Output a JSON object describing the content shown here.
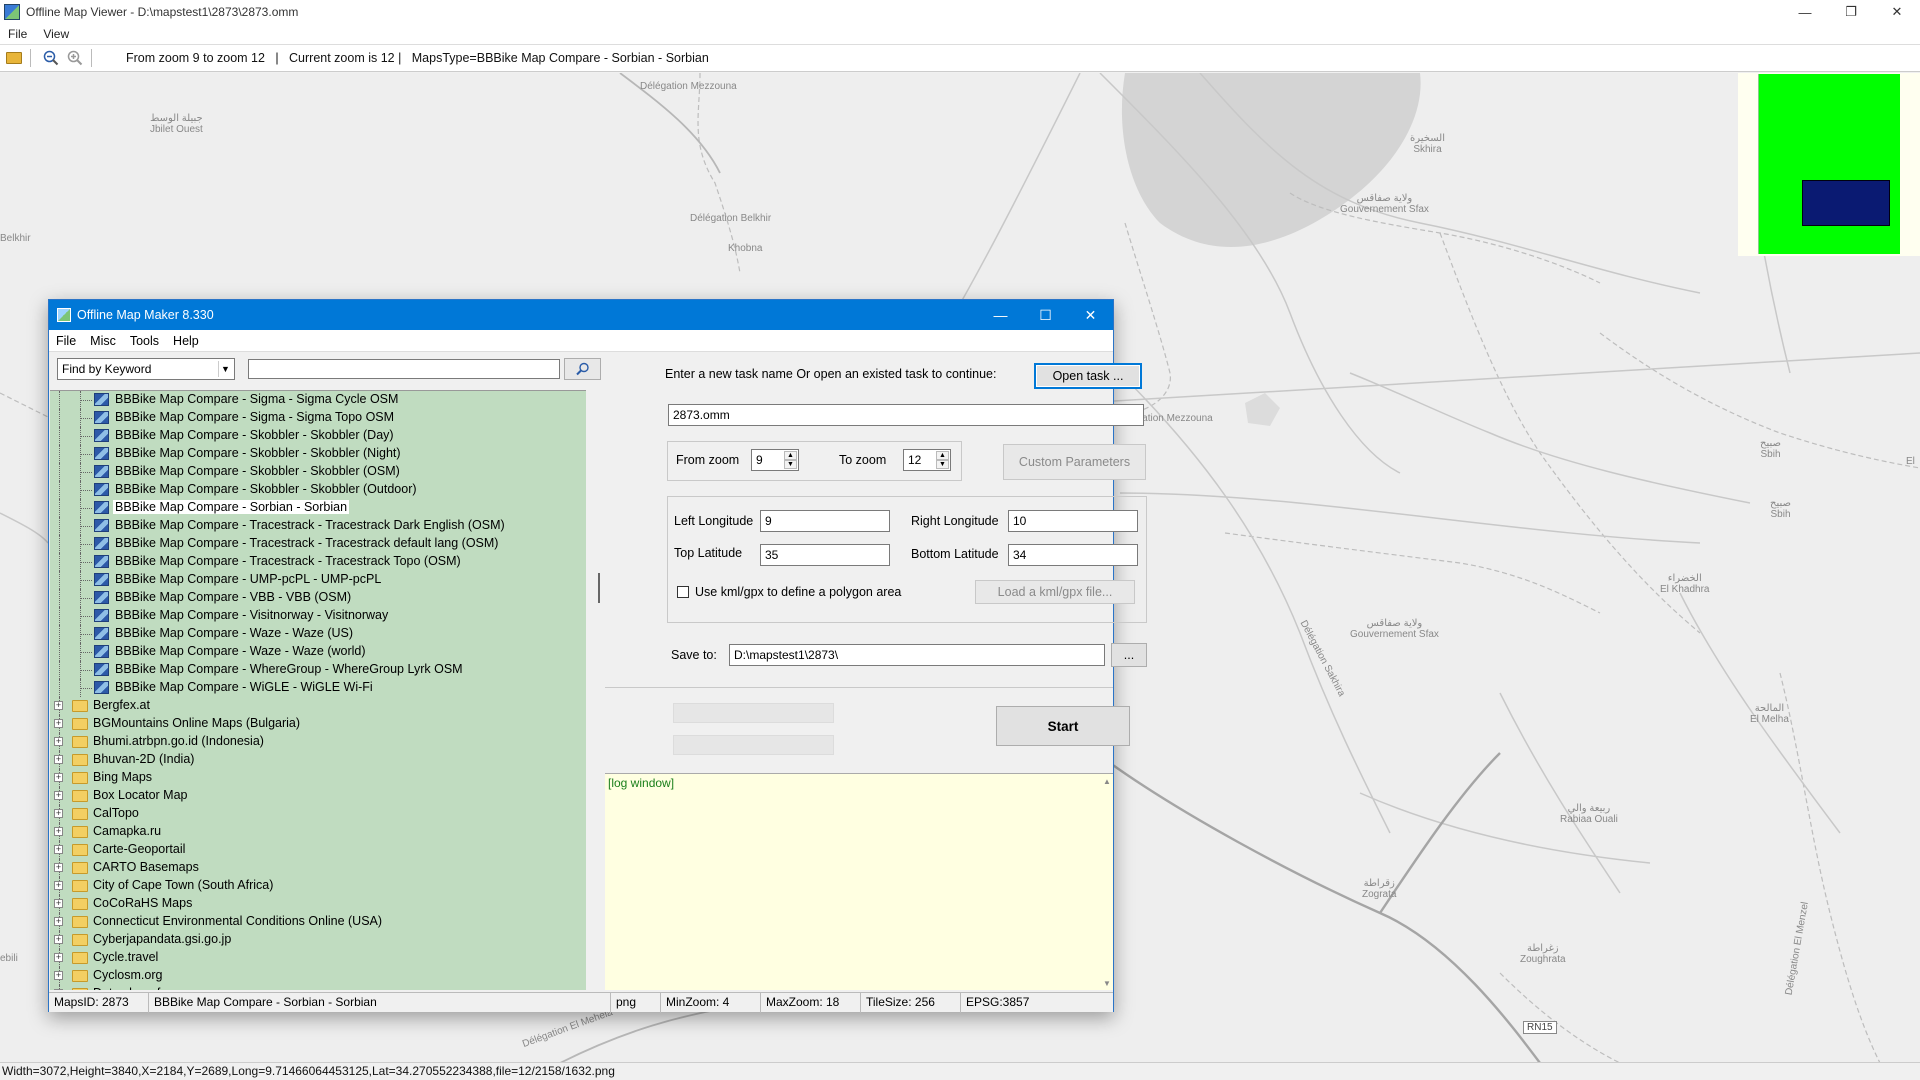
{
  "viewer": {
    "title": "Offline Map Viewer - D:\\mapstest1\\2873\\2873.omm",
    "menu": [
      "File",
      "View"
    ],
    "toolbar_info": "From zoom 9 to zoom 12   |   Current zoom is 12 |   MapsType=BBBike Map Compare - Sorbian - Sorbian",
    "status": "Width=3072,Height=3840,X=2184,Y=2689,Long=9.71466064453125,Lat=34.270552234388,file=12/2158/1632.png",
    "window_controls": {
      "minimize": "—",
      "restore": "❐",
      "close": "✕"
    },
    "icons": [
      "open-folder-icon",
      "zoom-out-icon",
      "zoom-in-icon"
    ]
  },
  "map_labels": [
    {
      "text": "Délégation Mezzouna"
    },
    {
      "text": "جبيلة الوسط\nJbilet Ouest"
    },
    {
      "text": "Belkhir"
    },
    {
      "text": "Délégation Belkhir"
    },
    {
      "text": "Khobna"
    },
    {
      "text": "السخيرة\nSkhira"
    },
    {
      "text": "ولاية صفاقس\nGouvernement Sfax"
    },
    {
      "text": "Délégation Mezzouna"
    },
    {
      "text": "صبيح\nSbih"
    },
    {
      "text": "صبيح\nSbih"
    },
    {
      "text": "El"
    },
    {
      "text": "الخضراء\nEl Khadhra"
    },
    {
      "text": "ولاية صفاقس\nGouvernement Sfax"
    },
    {
      "text": "Délégation Sakhira"
    },
    {
      "text": "المالحة\nEl Melha"
    },
    {
      "text": "ربيعة والي\nRabiaa Ouali"
    },
    {
      "text": "زقراطة\nZograta"
    },
    {
      "text": "زغراطة\nZoughrata"
    },
    {
      "text": "RN15"
    },
    {
      "text": "Délégation El Menzel"
    },
    {
      "text": "Délégation El Mehela"
    },
    {
      "text": "ebili"
    }
  ],
  "dialog": {
    "title": "Offline Map Maker 8.330",
    "menu": [
      "File",
      "Misc",
      "Tools",
      "Help"
    ],
    "search": {
      "mode": "Find by Keyword",
      "value": "",
      "button_icon": "magnifier-icon"
    },
    "map_items": [
      "BBBike Map Compare - Sigma - Sigma Cycle OSM",
      "BBBike Map Compare - Sigma - Sigma Topo OSM",
      "BBBike Map Compare - Skobbler - Skobbler (Day)",
      "BBBike Map Compare - Skobbler - Skobbler (Night)",
      "BBBike Map Compare - Skobbler - Skobbler (OSM)",
      "BBBike Map Compare - Skobbler - Skobbler (Outdoor)",
      "BBBike Map Compare - Sorbian - Sorbian",
      "BBBike Map Compare - Tracestrack - Tracestrack Dark English (OSM)",
      "BBBike Map Compare - Tracestrack - Tracestrack default lang (OSM)",
      "BBBike Map Compare - Tracestrack - Tracestrack Topo (OSM)",
      "BBBike Map Compare - UMP-pcPL - UMP-pcPL",
      "BBBike Map Compare - VBB - VBB (OSM)",
      "BBBike Map Compare - Visitnorway - Visitnorway",
      "BBBike Map Compare - Waze - Waze (US)",
      "BBBike Map Compare - Waze - Waze (world)",
      "BBBike Map Compare - WhereGroup - WhereGroup Lyrk OSM",
      "BBBike Map Compare - WiGLE - WiGLE Wi-Fi"
    ],
    "selected_item": "BBBike Map Compare - Sorbian - Sorbian",
    "folders": [
      "Bergfex.at",
      "BGMountains Online Maps (Bulgaria)",
      "Bhumi.atrbpn.go.id (Indonesia)",
      "Bhuvan-2D (India)",
      "Bing Maps",
      "Box Locator Map",
      "CalTopo",
      "Camapka.ru",
      "Carte-Geoportail",
      "CARTO Basemaps",
      "City of Cape Town (South Africa)",
      "CoCoRaHS Maps",
      "Connecticut Environmental Conditions Online (USA)",
      "Cyberjapandata.gsi.go.jp",
      "Cycle.travel",
      "Cyclosm.org",
      "Data.shom.fr"
    ],
    "task_prompt": "Enter a new task name Or open an existed task to continue:",
    "open_task_label": "Open task ...",
    "task_name": "2873.omm",
    "from_zoom_label": "From zoom",
    "from_zoom": "9",
    "to_zoom_label": "To zoom",
    "to_zoom": "12",
    "custom_params_label": "Custom Parameters",
    "left_lon_label": "Left Longitude",
    "left_lon": "9",
    "right_lon_label": "Right Longitude",
    "right_lon": "10",
    "top_lat_label": "Top Latitude",
    "top_lat": "35",
    "bottom_lat_label": "Bottom Latitude",
    "bottom_lat": "34",
    "kml_label": "Use kml/gpx to define a polygon area",
    "kml_checked": false,
    "load_kml_label": "Load a kml/gpx file...",
    "save_to_label": "Save to:",
    "save_to": "D:\\mapstest1\\2873\\",
    "browse_label": "...",
    "start_label": "Start",
    "log_text": "[log window]",
    "status": {
      "maps_id": "MapsID: 2873",
      "map_name": "BBBike Map Compare - Sorbian - Sorbian",
      "format": "png",
      "min_zoom": "MinZoom: 4",
      "max_zoom": "MaxZoom: 18",
      "tile_size": "TileSize: 256",
      "epsg": "EPSG:3857"
    }
  },
  "colors": {
    "tree_bg": "#c0dcc0",
    "title_blue": "#0078d7",
    "overview_green": "#00ff00",
    "overview_box": "#0a1a72",
    "log_bg": "#ffffe1"
  }
}
